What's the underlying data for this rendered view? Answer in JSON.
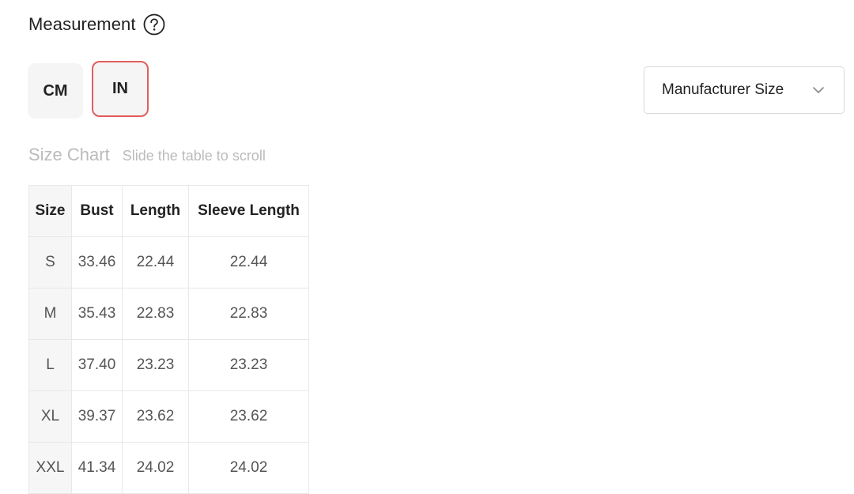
{
  "header": {
    "title": "Measurement",
    "help_icon": "question-circle-icon"
  },
  "units": {
    "cm_label": "CM",
    "in_label": "IN",
    "selected": "IN",
    "selected_border_color": "#e35d5d"
  },
  "size_type": {
    "selected": "Manufacturer Size",
    "icon": "chevron-down-icon"
  },
  "size_chart": {
    "label": "Size Chart",
    "hint": "Slide the table to scroll",
    "columns": [
      "Size",
      "Bust",
      "Length",
      "Sleeve Length"
    ],
    "rows": [
      [
        "S",
        "33.46",
        "22.44",
        "22.44"
      ],
      [
        "M",
        "35.43",
        "22.83",
        "22.83"
      ],
      [
        "L",
        "37.40",
        "23.23",
        "23.23"
      ],
      [
        "XL",
        "39.37",
        "23.62",
        "23.62"
      ],
      [
        "XXL",
        "41.34",
        "24.02",
        "24.02"
      ]
    ]
  }
}
